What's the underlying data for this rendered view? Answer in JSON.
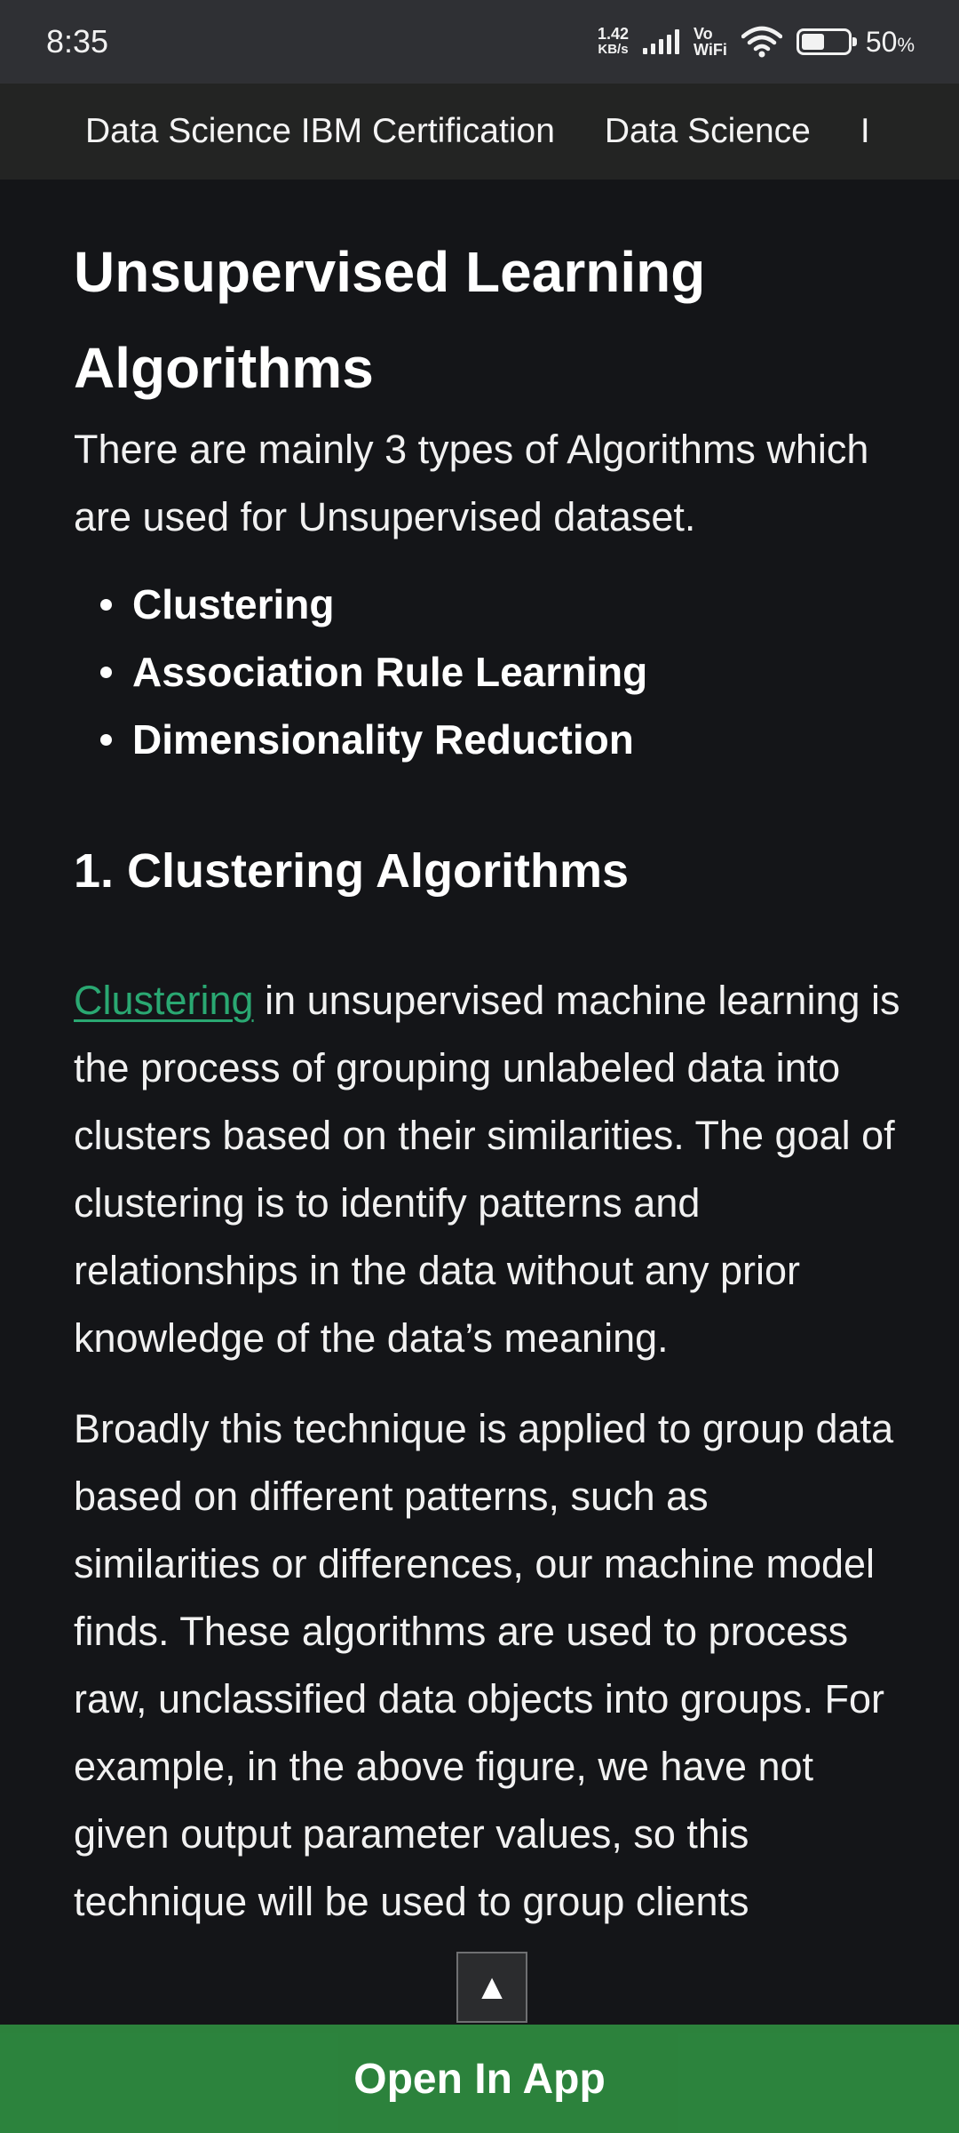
{
  "status_bar": {
    "time": "8:35",
    "net_speed_value": "1.42",
    "net_speed_unit": "KB/s",
    "vo_label": "Vo",
    "wifi_label": "WiFi",
    "battery_percent": "50",
    "battery_symbol": "%",
    "battery_level": 0.5
  },
  "topic_nav": {
    "items": [
      "Data Science IBM Certification",
      "Data Science"
    ],
    "overflow_marker": "I"
  },
  "article": {
    "title": "Unsupervised Learning Algorithms",
    "intro": "There are mainly 3 types of Algorithms which are used for Unsupervised dataset.",
    "algorithm_types": [
      "Clustering",
      "Association Rule Learning",
      "Dimensionality Reduction"
    ],
    "section_heading": "1. Clustering Algorithms",
    "clustering_link": "Clustering",
    "clustering_text": " in unsupervised machine learning is the process of grouping unlabeled data into clusters based on their similarities. The goal of clustering is to identify patterns and relationships in the data without any prior knowledge of the data’s meaning.",
    "broad_paragraph": "Broadly this technique is applied to group data based on different patterns, such as similarities or differences, our machine model finds. These algorithms are used to process raw, unclassified data objects into groups. For example, in the above figure, we have not given output parameter values, so this technique will be used to group clients"
  },
  "scroll_top_button": {
    "glyph": "▲"
  },
  "open_app": {
    "label": "Open In App"
  },
  "colors": {
    "background": "#141518",
    "status_bar": "#2f3034",
    "nav_bar": "#232423",
    "link": "#2aa872",
    "open_app_bar": "#2e8b40"
  }
}
